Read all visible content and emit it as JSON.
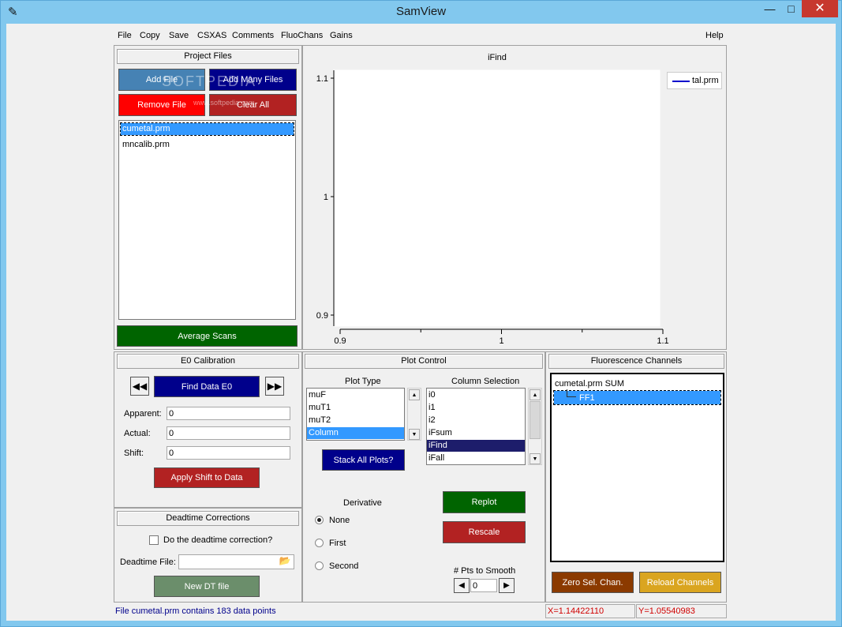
{
  "window": {
    "title": "SamView"
  },
  "menu": {
    "items": [
      "File",
      "Copy",
      "Save",
      "CSXAS",
      "Comments",
      "FluoChans",
      "Gains"
    ],
    "help": "Help"
  },
  "project_files": {
    "title": "Project Files",
    "add_file": "Add File",
    "add_many": "Add Many Files",
    "remove_file": "Remove File",
    "clear_all": "Clear All",
    "files": [
      "cumetal.prm",
      "mncalib.prm"
    ],
    "average_scans": "Average Scans",
    "watermark": "SOFTPEDIA",
    "watermark_url": "www.softpedia.com"
  },
  "chart_data": {
    "type": "line",
    "title": "iFind",
    "x": [],
    "series": [
      {
        "name": "tal.prm",
        "values": [],
        "color": "#0000cc"
      }
    ],
    "xlim": [
      0.9,
      1.1
    ],
    "ylim": [
      0.9,
      1.1
    ],
    "xticks": [
      "0.9",
      "1",
      "1.1"
    ],
    "yticks": [
      "1.1",
      "1",
      "0.9"
    ],
    "grid": false,
    "legend": "top-right"
  },
  "e0": {
    "title": "E0 Calibration",
    "find": "Find Data E0",
    "apparent_label": "Apparent:",
    "apparent": "0",
    "actual_label": "Actual:",
    "actual": "0",
    "shift_label": "Shift:",
    "shift": "0",
    "apply": "Apply Shift to Data"
  },
  "deadtime": {
    "title": "Deadtime Corrections",
    "checkbox_label": "Do the deadtime correction?",
    "file_label": "Deadtime File:",
    "file_value": "",
    "new_dt": "New DT file"
  },
  "plot_control": {
    "title": "Plot Control",
    "plot_type_label": "Plot Type",
    "plot_types": [
      "muF",
      "muT1",
      "muT2",
      "Column"
    ],
    "column_label": "Column Selection",
    "columns": [
      "i0",
      "i1",
      "i2",
      "iFsum",
      "iFind",
      "iFall"
    ],
    "stack": "Stack All Plots?",
    "derivative_label": "Derivative",
    "derivative_options": [
      "None",
      "First",
      "Second"
    ],
    "replot": "Replot",
    "rescale": "Rescale",
    "smooth_label": "# Pts to Smooth",
    "smooth_value": "0"
  },
  "fluo": {
    "title": "Fluorescence Channels",
    "root": "cumetal.prm SUM",
    "child": "FF1",
    "zero": "Zero Sel. Chan.",
    "reload": "Reload Channels"
  },
  "status": {
    "message": "File cumetal.prm contains 183 data points",
    "x_readout": "X=1.14422110",
    "y_readout": "Y=1.05540983"
  },
  "colors": {
    "green": "#006400",
    "red": "#b22222",
    "navy": "#00008b",
    "orange": "#8b3a00",
    "gold": "#daa520"
  }
}
